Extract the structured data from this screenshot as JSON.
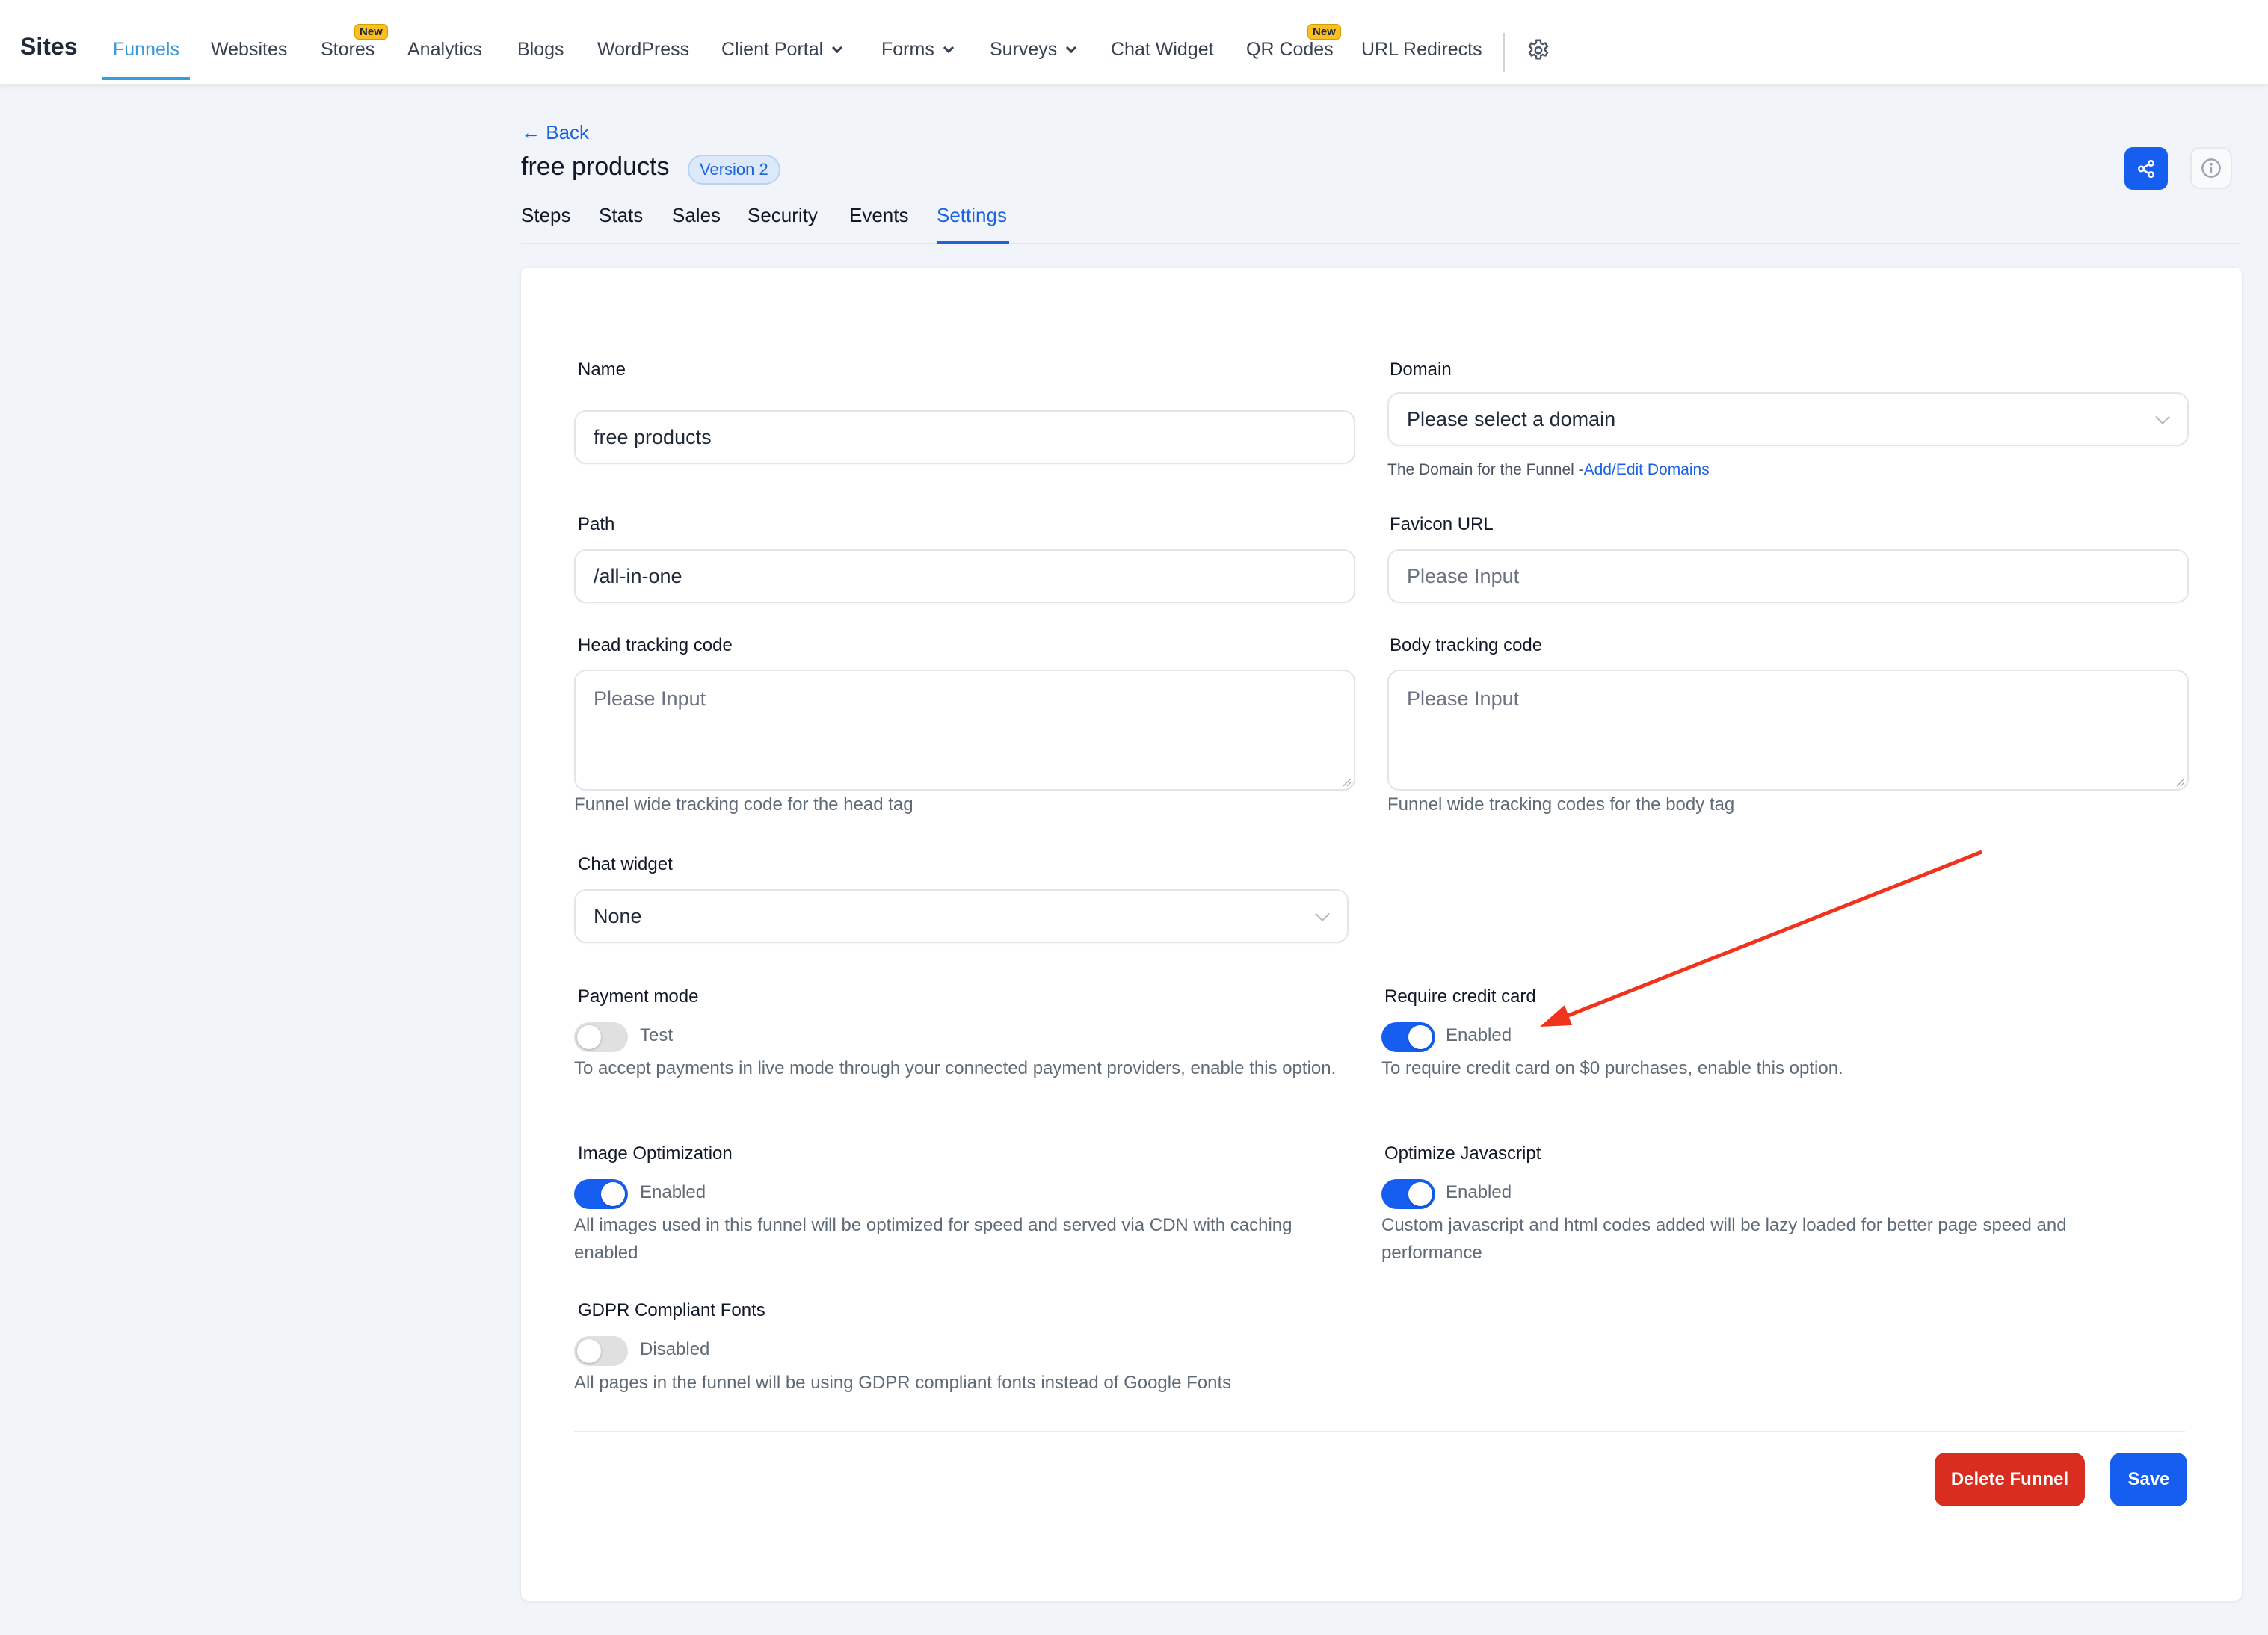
{
  "topnav": {
    "brand": "Sites",
    "items": [
      {
        "label": "Funnels",
        "active": true
      },
      {
        "label": "Websites"
      },
      {
        "label": "Stores",
        "badge": "New"
      },
      {
        "label": "Analytics"
      },
      {
        "label": "Blogs"
      },
      {
        "label": "WordPress"
      },
      {
        "label": "Client Portal",
        "dropdown": true
      },
      {
        "label": "Forms",
        "dropdown": true
      },
      {
        "label": "Surveys",
        "dropdown": true
      },
      {
        "label": "Chat Widget"
      },
      {
        "label": "QR Codes",
        "badge": "New"
      },
      {
        "label": "URL Redirects"
      }
    ],
    "settings_icon": "gear-icon"
  },
  "header": {
    "back_label": "Back",
    "title": "free products",
    "version_badge": "Version 2",
    "tabs": [
      {
        "label": "Steps"
      },
      {
        "label": "Stats"
      },
      {
        "label": "Sales"
      },
      {
        "label": "Security"
      },
      {
        "label": "Events"
      },
      {
        "label": "Settings",
        "active": true
      }
    ],
    "share_icon": "share-icon",
    "info_icon": "info-icon"
  },
  "form": {
    "name": {
      "label": "Name",
      "value": "free products"
    },
    "domain": {
      "label": "Domain",
      "placeholder": "Please select a domain",
      "help_prefix": "The Domain for the Funnel -",
      "help_link": "Add/Edit Domains"
    },
    "path": {
      "label": "Path",
      "value": "/all-in-one"
    },
    "favicon": {
      "label": "Favicon URL",
      "placeholder": "Please Input"
    },
    "head_tracking": {
      "label": "Head tracking code",
      "placeholder": "Please Input",
      "help": "Funnel wide tracking code for the head tag"
    },
    "body_tracking": {
      "label": "Body tracking code",
      "placeholder": "Please Input",
      "help": "Funnel wide tracking codes for the body tag"
    },
    "chat_widget": {
      "label": "Chat widget",
      "value": "None"
    },
    "payment_mode": {
      "label": "Payment mode",
      "enabled": false,
      "state_label": "Test",
      "help": "To accept payments in live mode through your connected payment providers, enable this option."
    },
    "require_credit_card": {
      "label": "Require credit card",
      "enabled": true,
      "state_label": "Enabled",
      "help": "To require credit card on $0 purchases, enable this option."
    },
    "image_optimization": {
      "label": "Image Optimization",
      "enabled": true,
      "state_label": "Enabled",
      "help": "All images used in this funnel will be optimized for speed and served via CDN with caching enabled"
    },
    "optimize_javascript": {
      "label": "Optimize Javascript",
      "enabled": true,
      "state_label": "Enabled",
      "help": "Custom javascript and html codes added will be lazy loaded for better page speed and performance"
    },
    "gdpr_fonts": {
      "label": "GDPR Compliant Fonts",
      "enabled": false,
      "state_label": "Disabled",
      "help": "All pages in the funnel will be using GDPR compliant fonts instead of Google Fonts"
    }
  },
  "actions": {
    "delete_label": "Delete Funnel",
    "save_label": "Save"
  },
  "colors": {
    "primary": "#155eef",
    "nav_active": "#3b9ad9",
    "danger": "#d92d20",
    "badge": "#fbbf24",
    "annotation_arrow": "#f0341c"
  }
}
